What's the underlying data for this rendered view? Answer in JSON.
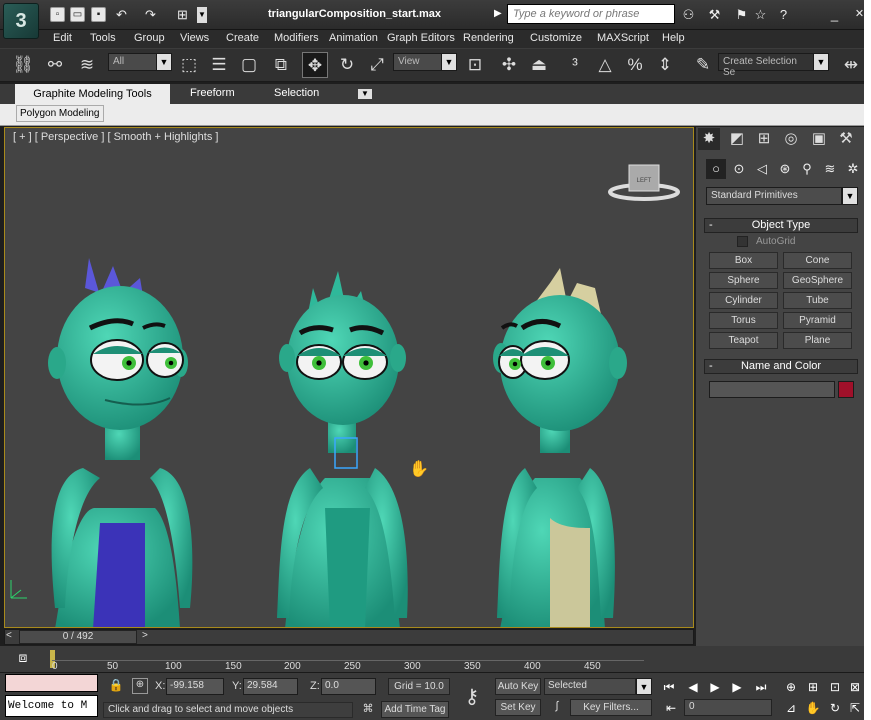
{
  "window": {
    "title": "triangularComposition_start.max",
    "logo_glyph": "3",
    "search_placeholder": "Type a keyword or phrase"
  },
  "menu": [
    "Edit",
    "Tools",
    "Group",
    "Views",
    "Create",
    "Modifiers",
    "Animation",
    "Graph Editors",
    "Rendering",
    "Customize",
    "MAXScript",
    "Help"
  ],
  "toolbar": {
    "selection_filter": "All",
    "ref_coord": "View",
    "named_selection_placeholder": "Create Selection Se"
  },
  "ribbon": {
    "tabs": [
      "Graphite Modeling Tools",
      "Freeform",
      "Selection"
    ],
    "panel_label": "Polygon Modeling"
  },
  "viewport": {
    "label": "[ + ] [ Perspective ] [ Smooth + Highlights ]",
    "viewcube_label": "LEFT",
    "border_color": "#a88a1c",
    "bg_color": "#444444",
    "character_color": "#2fb89a"
  },
  "command_panel": {
    "dropdown": "Standard Primitives",
    "object_type_header": "Object Type",
    "autogrid_label": "AutoGrid",
    "buttons": [
      "Box",
      "Cone",
      "Sphere",
      "GeoSphere",
      "Cylinder",
      "Tube",
      "Torus",
      "Pyramid",
      "Teapot",
      "Plane"
    ],
    "name_color_header": "Name and Color",
    "object_color": "#a0102a"
  },
  "timeline": {
    "frame_display": "0 / 492",
    "ticks": [
      "0",
      "50",
      "100",
      "150",
      "200",
      "250",
      "300",
      "350",
      "400",
      "450"
    ]
  },
  "status": {
    "maxscript_text": "Welcome to M",
    "x_label": "X:",
    "x_value": "-99.158",
    "y_label": "Y:",
    "y_value": "29.584",
    "z_label": "Z:",
    "z_value": "0.0",
    "grid": "Grid = 10.0",
    "prompt": "Click and drag to select and move objects",
    "add_time_tag": "Add Time Tag",
    "auto_key": "Auto Key",
    "set_key": "Set Key",
    "key_mode": "Selected",
    "key_filters": "Key Filters...",
    "current_frame": "0"
  }
}
